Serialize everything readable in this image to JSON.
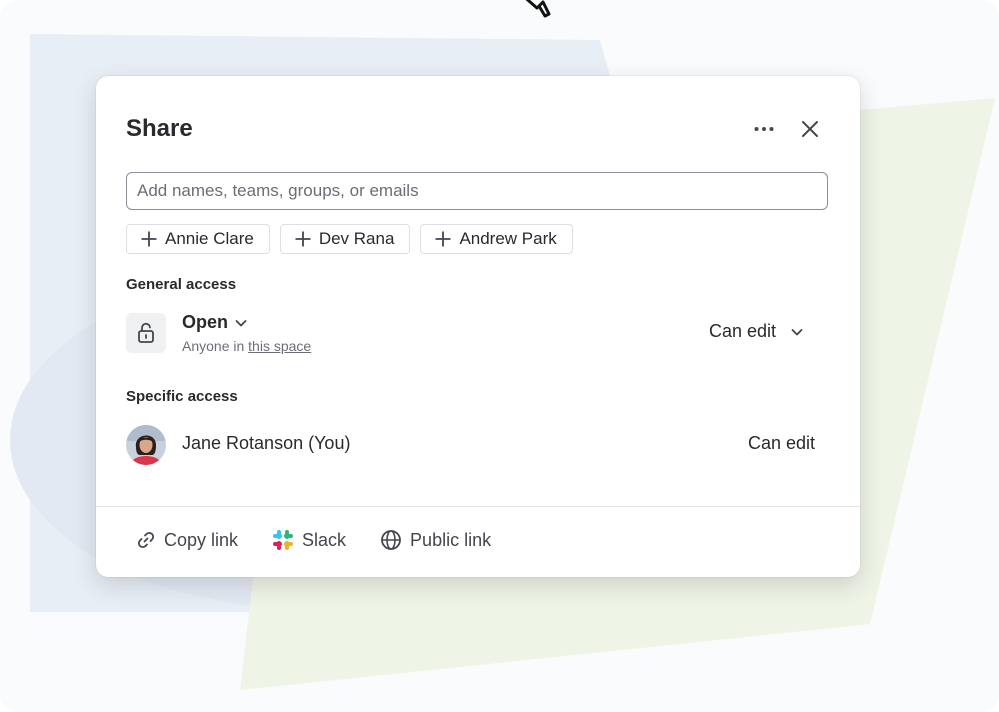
{
  "dialog": {
    "title": "Share",
    "more_icon": "more-horizontal-icon",
    "close_icon": "close-icon"
  },
  "search": {
    "placeholder": "Add names, teams, groups, or emails",
    "value": ""
  },
  "suggestions": [
    {
      "label": "Annie Clare"
    },
    {
      "label": "Dev Rana"
    },
    {
      "label": "Andrew Park"
    }
  ],
  "general_access": {
    "heading": "General access",
    "icon": "unlock-icon",
    "mode": "Open",
    "description_prefix": "Anyone in",
    "description_link": "this space",
    "permission": "Can edit"
  },
  "specific_access": {
    "heading": "Specific access",
    "users": [
      {
        "name": "Jane Rotanson (You)",
        "permission": "Can edit"
      }
    ]
  },
  "footer": {
    "copy_link": "Copy link",
    "slack": "Slack",
    "public_link": "Public link"
  },
  "colors": {
    "text": "#292a2e",
    "subtle": "#6b6e76",
    "border": "#8c8f97",
    "chip_border": "#dcdfe4",
    "bg_blue": "#e6ecf5",
    "bg_green": "#eef4e6"
  }
}
